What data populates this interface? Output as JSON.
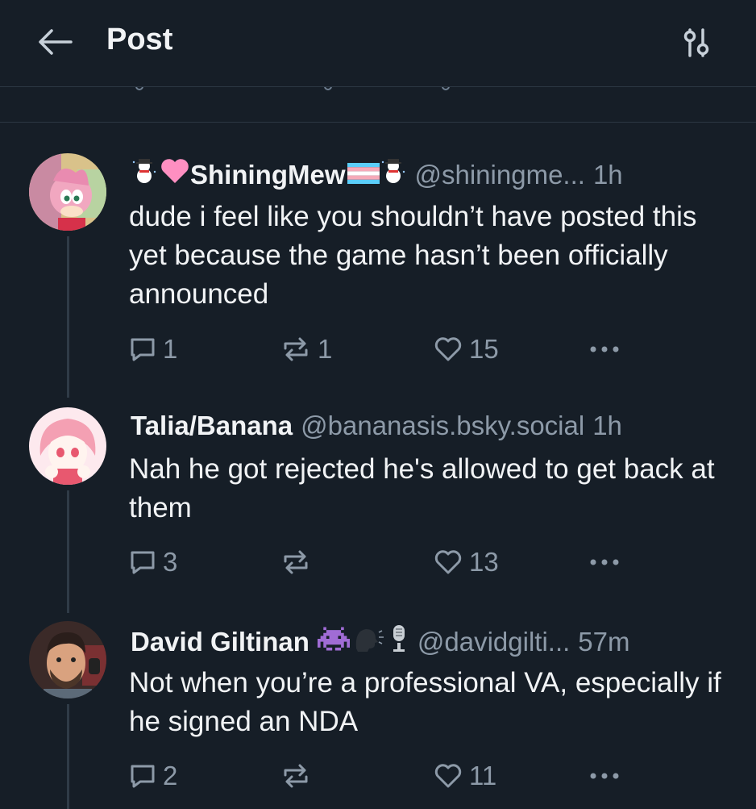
{
  "header": {
    "title": "Post"
  },
  "colors": {
    "background": "#161e27",
    "text": "#f1f3f5",
    "muted": "#8d9aa8",
    "divider": "#2c3743",
    "heart_pink": "#ff6b9d"
  },
  "replies": [
    {
      "display_name": "ShiningMew",
      "handle": "@shiningme...",
      "time": "1h",
      "text": "dude i feel like you shouldn’t have posted this yet because the game hasn’t been officially announced",
      "reply_count": "1",
      "repost_count": "1",
      "like_count": "15",
      "name_emojis": [
        "snowman-icon",
        "pink-heart-icon",
        "trans-flag-icon",
        "snowman-icon"
      ]
    },
    {
      "display_name": "Talia/Banana",
      "handle": "@bananasis.bsky.social",
      "time": "1h",
      "text": "Nah he got rejected he's allowed to get back at them",
      "reply_count": "3",
      "repost_count": "",
      "like_count": "13",
      "name_emojis": []
    },
    {
      "display_name": "David Giltinan",
      "handle": "@davidgilti...",
      "time": "57m",
      "text": "Not when you’re a professional VA, especially if he signed an NDA",
      "reply_count": "2",
      "repost_count": "",
      "like_count": "11",
      "name_emojis": [
        "space-invader-icon",
        "speaking-head-icon",
        "microphone-icon"
      ]
    }
  ]
}
